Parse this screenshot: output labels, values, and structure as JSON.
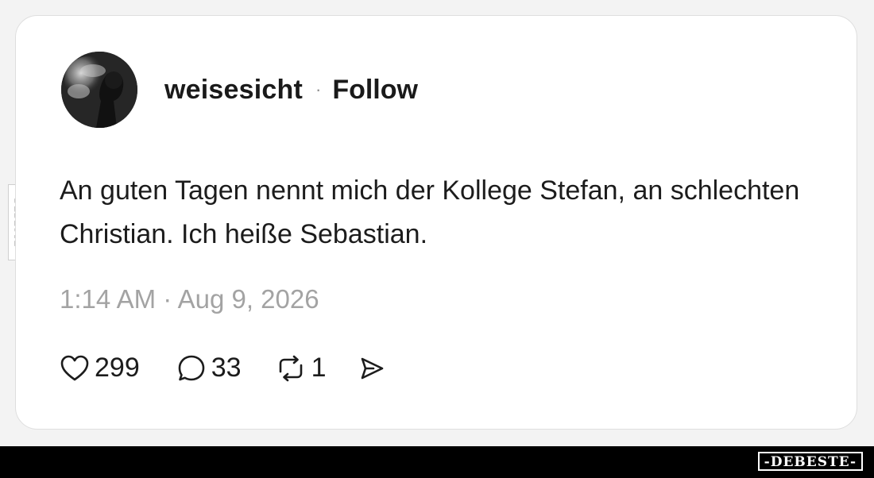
{
  "post": {
    "username": "weisesicht",
    "separator": "·",
    "follow_label": "Follow",
    "text": "An guten Tagen nennt mich der Kollege Stefan, an schlechten Christian. Ich heiße Sebastian.",
    "timestamp": "1:14 AM · Aug 9, 2026",
    "actions": {
      "likes": "299",
      "replies": "33",
      "reposts": "1"
    },
    "icons": {
      "like": "heart-icon",
      "reply": "speech-bubble-icon",
      "repost": "repost-icon",
      "share": "send-icon"
    }
  },
  "watermark": {
    "side_tag": "DEBESTE",
    "brand": "-DEBESTE-"
  },
  "colors": {
    "text": "#1c1c1c",
    "muted": "#a3a3a3",
    "card_border": "#dedede",
    "footer": "#000000"
  }
}
